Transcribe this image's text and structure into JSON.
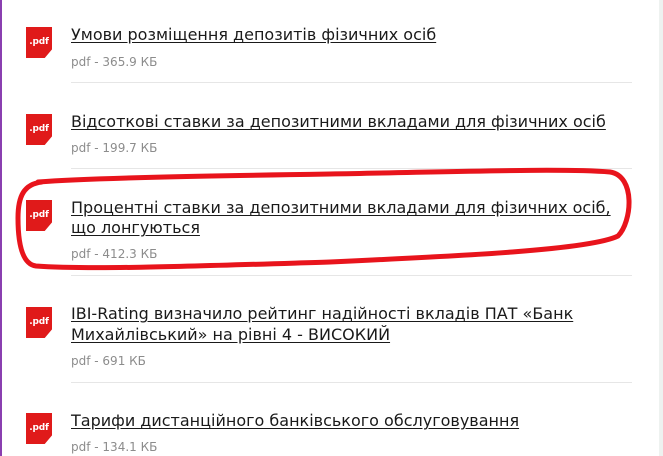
{
  "documents": [
    {
      "icon_label": ".pdf",
      "title": "Умови розміщення депозитів фізичних осіб",
      "title_line2": "",
      "meta": "pdf - 365.9 КБ"
    },
    {
      "icon_label": ".pdf",
      "title": "Відсоткові ставки за депозитними вкладами для фізичних осіб",
      "title_line2": "",
      "meta": "pdf - 199.7 КБ"
    },
    {
      "icon_label": ".pdf",
      "title": "Процентні ставки за депозитними вкладами для фізичних осіб,",
      "title_line2": "що лонгуються",
      "meta": "pdf - 412.3 КБ"
    },
    {
      "icon_label": ".pdf",
      "title": "IBI-Rating визначило рейтинг надійності вкладів ПАТ «Банк",
      "title_line2": "Михайлівський» на рівні 4 - ВИСОКИЙ",
      "meta": "pdf - 691 КБ"
    },
    {
      "icon_label": ".pdf",
      "title": "Тарифи дистанційного банківського обслуговування",
      "title_line2": "",
      "meta": "pdf - 134.1 КБ"
    }
  ],
  "colors": {
    "pdf_icon": "#e01a1a",
    "highlight_stroke": "#e8141c",
    "left_border": "#8a3fb0"
  },
  "icons": {
    "pdf": "pdf-file-icon"
  }
}
